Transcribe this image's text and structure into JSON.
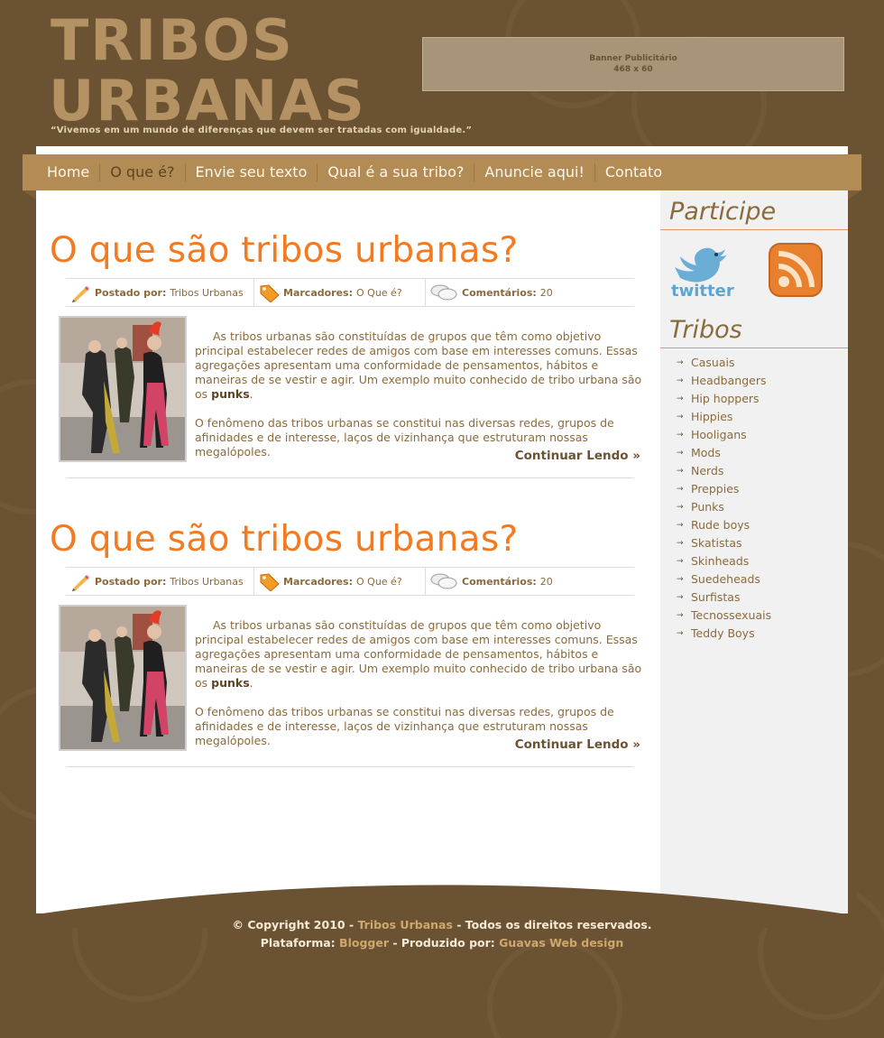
{
  "header": {
    "logo_line1": "TRIBOS",
    "logo_line2": "URBANAS",
    "tagline": "“Vivemos em um mundo de diferenças que devem ser tratadas com igualdade.”",
    "banner_line1": "Banner Publicitário",
    "banner_line2": "468 x 60"
  },
  "nav": {
    "items": [
      "Home",
      "O que é?",
      "Envie seu texto",
      "Qual é a sua tribo?",
      "Anuncie aqui!",
      "Contato"
    ],
    "active_index": 1
  },
  "posts": [
    {
      "title": "O que são tribos urbanas?",
      "posted_by_label": "Postado por:",
      "posted_by": "Tribos Urbanas",
      "tags_label": "Marcadores:",
      "tags": "O Que é?",
      "comments_label": "Comentários:",
      "comments": "20",
      "para1": "As tribos urbanas são constituídas de grupos que têm como objetivo principal estabelecer redes de amigos com base em interesses comuns. Essas agregações apresentam uma conformidade de pensamentos, hábitos e maneiras de se vestir e agir. Um exemplo muito conhecido de tribo urbana são os",
      "para1_bold": "punks",
      "para2": "O fenômeno das tribos urbanas se constitui nas diversas redes, grupos de afinidades e de interesse, laços de vizinhança que estruturam nossas megalópoles.",
      "more": "Continuar Lendo »"
    },
    {
      "title": "O que são tribos urbanas?",
      "posted_by_label": "Postado por:",
      "posted_by": "Tribos Urbanas",
      "tags_label": "Marcadores:",
      "tags": "O Que é?",
      "comments_label": "Comentários:",
      "comments": "20",
      "para1": "As tribos urbanas são constituídas de grupos que têm como objetivo principal estabelecer redes de amigos com base em interesses comuns. Essas agregações apresentam uma conformidade de pensamentos, hábitos e maneiras de se vestir e agir. Um exemplo muito conhecido de tribo urbana são os",
      "para1_bold": "punks",
      "para2": "O fenômeno das tribos urbanas se constitui nas diversas redes, grupos de afinidades e de interesse, laços de vizinhança que estruturam nossas megalópoles.",
      "more": "Continuar Lendo »"
    }
  ],
  "sidebar": {
    "participe_title": "Participe",
    "twitter_label": "twitter",
    "tribos_title": "Tribos",
    "tribos": [
      "Casuais",
      "Headbangers",
      "Hip hoppers",
      "Hippies",
      "Hooligans",
      "Mods",
      "Nerds",
      "Preppies",
      "Punks",
      "Rude boys",
      "Skatistas",
      "Skinheads",
      "Suedeheads",
      "Surfistas",
      "Tecnossexuais",
      "Teddy Boys"
    ]
  },
  "footer": {
    "copyright_prefix": "© Copyright 2010 -",
    "site_link": "Tribos Urbanas",
    "copyright_suffix": "- Todos os direitos reservados.",
    "platform_label": "Plataforma:",
    "platform_link": "Blogger",
    "produced_label": "- Produzido por:",
    "producer_link": "Guavas Web design"
  },
  "colors": {
    "background": "#6b5232",
    "nav": "#b28c54",
    "title_orange": "#f47a20",
    "text_brown": "#8a6a3a",
    "logo": "#b49263"
  }
}
